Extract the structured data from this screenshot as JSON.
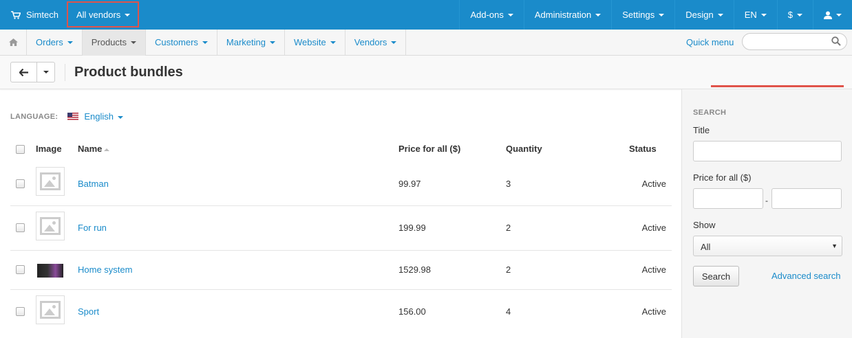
{
  "topbar": {
    "brand": "Simtech",
    "vendors": "All vendors",
    "items": [
      "Add-ons",
      "Administration",
      "Settings",
      "Design",
      "EN",
      "$"
    ],
    "colors": {
      "primary": "#1a8bca",
      "highlight": "#e0534a"
    }
  },
  "navbar": {
    "items": [
      "Orders",
      "Products",
      "Customers",
      "Marketing",
      "Website",
      "Vendors"
    ],
    "active": "Products",
    "quick_menu": "Quick menu",
    "search_placeholder": ""
  },
  "page": {
    "title": "Product bundles"
  },
  "language": {
    "label": "LANGUAGE:",
    "value": "English"
  },
  "table": {
    "headers": {
      "image": "Image",
      "name": "Name",
      "price": "Price for all ($)",
      "quantity": "Quantity",
      "status": "Status"
    },
    "rows": [
      {
        "name": "Batman",
        "price": "99.97",
        "quantity": "3",
        "status": "Active"
      },
      {
        "name": "For run",
        "price": "199.99",
        "quantity": "2",
        "status": "Active"
      },
      {
        "name": "Home system",
        "price": "1529.98",
        "quantity": "2",
        "status": "Active"
      },
      {
        "name": "Sport",
        "price": "156.00",
        "quantity": "4",
        "status": "Active"
      }
    ]
  },
  "sidebar": {
    "heading": "SEARCH",
    "title_label": "Title",
    "title_value": "",
    "price_label": "Price for all ($)",
    "price_from": "",
    "price_to": "",
    "price_sep": "-",
    "show_label": "Show",
    "show_value": "All",
    "search_button": "Search",
    "advanced": "Advanced search"
  }
}
